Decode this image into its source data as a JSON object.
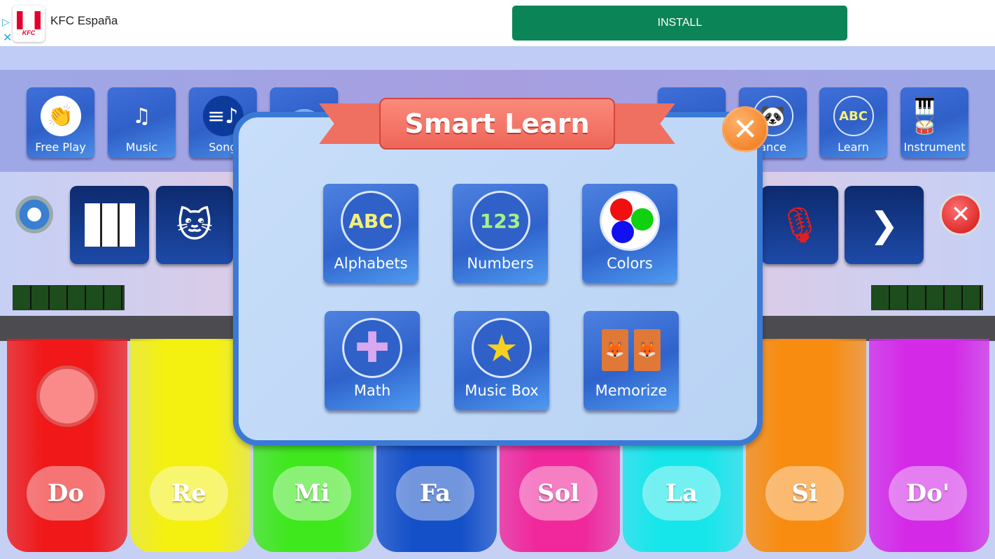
{
  "ad": {
    "advertiser": "KFC España",
    "logo_text": "KFC",
    "install_label": "INSTALL",
    "colors": {
      "install": "#0b8457"
    }
  },
  "toolbar": {
    "items": [
      {
        "label": "Free Play",
        "icon": "clapping-hands-icon"
      },
      {
        "label": "Music",
        "icon": "music-note-muted-icon"
      },
      {
        "label": "Song",
        "icon": "song-list-icon"
      },
      {
        "label": "",
        "icon": "play-icon"
      },
      {
        "label": "",
        "icon": "microphone-icon"
      },
      {
        "label": "ance",
        "icon": "panda-icon"
      },
      {
        "label": "Learn",
        "icon": "abc-icon"
      },
      {
        "label": "Instrument",
        "icon": "instruments-icon"
      }
    ]
  },
  "row2": {
    "icons": [
      "gear-icon",
      "piano-keys-icon",
      "cat-icon",
      "microphone-icon",
      "next-arrow-icon",
      "close-icon"
    ],
    "next_glyph": "❯"
  },
  "modal": {
    "title": "Smart Learn",
    "close_glyph": "✕",
    "tiles": [
      {
        "label": "Alphabets",
        "icon_text": "ABC",
        "icon": "abc-icon"
      },
      {
        "label": "Numbers",
        "icon_text": "123",
        "icon": "numbers-icon"
      },
      {
        "label": "Colors",
        "icon": "color-dots-icon"
      },
      {
        "label": "Math",
        "icon": "plus-icon"
      },
      {
        "label": "Music Box",
        "icon": "star-icon"
      },
      {
        "label": "Memorize",
        "icon": "memory-cards-icon"
      }
    ]
  },
  "keys": [
    {
      "label": "Do",
      "color": "#f01818"
    },
    {
      "label": "Re",
      "color": "#f4f010"
    },
    {
      "label": "Mi",
      "color": "#3ee81c"
    },
    {
      "label": "Fa",
      "color": "#1450c8"
    },
    {
      "label": "Sol",
      "color": "#f0289c"
    },
    {
      "label": "La",
      "color": "#16e6ea"
    },
    {
      "label": "Si",
      "color": "#f88c10"
    },
    {
      "label": "Do'",
      "color": "#d42ae8"
    }
  ]
}
